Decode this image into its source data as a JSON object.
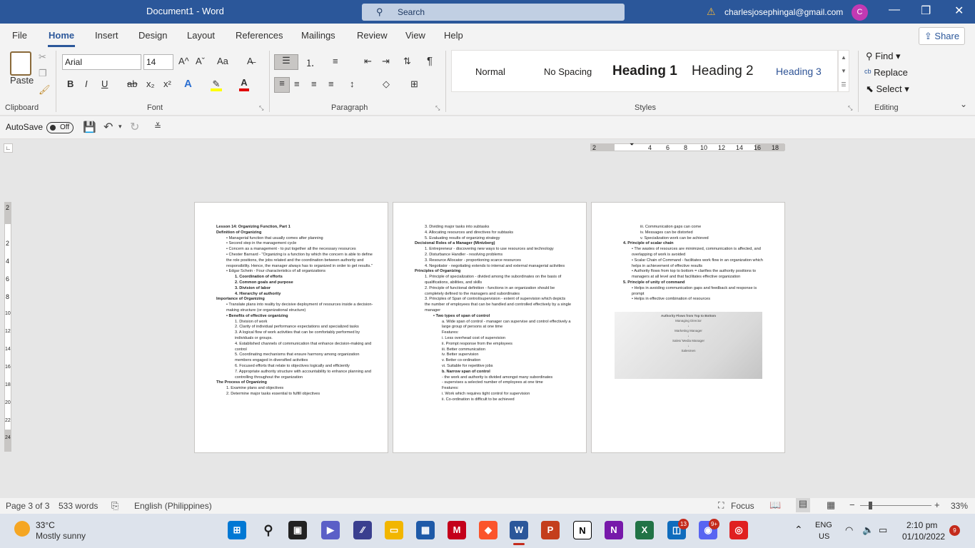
{
  "window": {
    "title": "Document1  -  Word",
    "search_placeholder": "Search",
    "account": "charlesjosephingal@gmail.com",
    "avatar": "C",
    "minimize": "—",
    "restore": "❐",
    "close": "✕"
  },
  "menu": {
    "tabs": [
      "File",
      "Home",
      "Insert",
      "Design",
      "Layout",
      "References",
      "Mailings",
      "Review",
      "View",
      "Help"
    ],
    "active": "Home",
    "share": "Share"
  },
  "ribbon": {
    "clipboard": {
      "paste": "Paste",
      "label": "Clipboard"
    },
    "font": {
      "family": "Arial",
      "size": "14",
      "label": "Font",
      "bold": "B",
      "italic": "I",
      "underline": "U",
      "strike": "ab",
      "sub": "x₂",
      "sup": "x²",
      "grow": "A^",
      "shrink": "Aˇ",
      "case": "Aa",
      "effects": "A",
      "color": "A"
    },
    "paragraph": {
      "label": "Paragraph"
    },
    "styles": {
      "items": [
        "Normal",
        "No Spacing",
        "Heading 1",
        "Heading 2",
        "Heading 3"
      ],
      "label": "Styles"
    },
    "editing": {
      "find": "Find",
      "replace": "Replace",
      "select": "Select",
      "label": "Editing"
    }
  },
  "qat": {
    "autosave": "AutoSave",
    "autosave_state": "Off"
  },
  "ruler": {
    "h_ticks": [
      "2",
      "2",
      "4",
      "6",
      "8",
      "10",
      "12",
      "14",
      "16",
      "18"
    ],
    "v_ticks": [
      "2",
      "2",
      "4",
      "6",
      "8",
      "10",
      "12",
      "14",
      "16",
      "18",
      "20",
      "22",
      "24"
    ]
  },
  "pages": {
    "p1": [
      {
        "t": "Lesson 14: Organizing Function, Part 1",
        "c": "h"
      },
      {
        "t": "Definition of Organizing",
        "c": "h"
      },
      {
        "t": "• Managerial function that usually comes after planning",
        "c": "ind"
      },
      {
        "t": "• Second step in the management cycle",
        "c": "ind"
      },
      {
        "t": "• Concern as a management - to put together all the necessary resources",
        "c": "ind"
      },
      {
        "t": "• Chester Barnard - \"Organizing is a function by which the concern is able to define the role positions, the jobs related and the coordination between authority and responsibility. Hence, the manager always has to organized in order to get results.\"",
        "c": "ind"
      },
      {
        "t": "• Edgar Schein - Four characteristics of all organizations",
        "c": "ind"
      },
      {
        "t": "1. Coordination of efforts",
        "c": "ind2 h"
      },
      {
        "t": "2. Common goals and purpose",
        "c": "ind2 h"
      },
      {
        "t": "3. Division of labor",
        "c": "ind2 h"
      },
      {
        "t": "4. Hierarchy of authority",
        "c": "ind2 h"
      },
      {
        "t": "Importance of Organizing",
        "c": "h"
      },
      {
        "t": "• Translate plans into reality by decisive deployment of resources inside a decision-making structure (or organizational structure)",
        "c": "ind"
      },
      {
        "t": "• Benefits of effective organizing",
        "c": "ind h"
      },
      {
        "t": "1. Division of work",
        "c": "ind2"
      },
      {
        "t": "2. Clarity of individual performance expectations and specialized tasks",
        "c": "ind2"
      },
      {
        "t": "3. A logical flow of work activities that can be comfortably performed by individuals or groups.",
        "c": "ind2"
      },
      {
        "t": "4. Established channels of communication that enhance decision-making and control",
        "c": "ind2"
      },
      {
        "t": "5. Coordinating mechanisms that ensure harmony among organization members engaged in diversified activities",
        "c": "ind2"
      },
      {
        "t": "6. Focused efforts that relate to objectives logically and efficiently",
        "c": "ind2"
      },
      {
        "t": "7. Appropriate authority structure with accountability to enhance planning and controlling throughout the organization",
        "c": "ind2"
      },
      {
        "t": "The Process of Organizing",
        "c": "h"
      },
      {
        "t": "1. Examine plans and objectives",
        "c": "ind"
      },
      {
        "t": "2. Determine major tasks essential to fulfill objectives",
        "c": "ind"
      }
    ],
    "p2": [
      {
        "t": "3. Dividing major tasks into subtasks",
        "c": "ind"
      },
      {
        "t": "4. Allocating resources and directives for subtasks",
        "c": "ind"
      },
      {
        "t": "5. Evaluating results of organizing strategy",
        "c": "ind"
      },
      {
        "t": "Decisional Roles of a Manager (Mintzberg)",
        "c": "h"
      },
      {
        "t": "1. Entrepreneur - discovering new ways to use resources and technology",
        "c": "ind"
      },
      {
        "t": "2. Disturbance Handler - resolving problems",
        "c": "ind"
      },
      {
        "t": "3. Resource Allocator - proportioning scarce resources",
        "c": "ind"
      },
      {
        "t": "4. Negotiator - negotiating extends to internal and external managerial activities",
        "c": "ind"
      },
      {
        "t": "Principles of Organizing",
        "c": "h"
      },
      {
        "t": "1. Principle of specialization - divided among the subordinates on the basis of qualifications, abilities, and skills",
        "c": "ind"
      },
      {
        "t": "2. Principle of functional definition - functions in an organization should be completely defined to the managers and subordinates",
        "c": "ind"
      },
      {
        "t": "3. Principles of Span of control/supervision - extent of supervision which depicts the number of employees that can be handled and controlled effectively by a single manager",
        "c": "ind"
      },
      {
        "t": "• Two types of span of control",
        "c": "ind2 h"
      },
      {
        "t": "a. Wide span of control - manager can supervise and control effectively a large group of persons at one time",
        "c": "ind3"
      },
      {
        "t": "Features:",
        "c": "ind3"
      },
      {
        "t": "i. Less overhead cost of supervision",
        "c": "ind3"
      },
      {
        "t": "ii. Prompt response from the employees",
        "c": "ind3"
      },
      {
        "t": "iii. Better communication",
        "c": "ind3"
      },
      {
        "t": "iv. Better supervision",
        "c": "ind3"
      },
      {
        "t": "v. Better co-ordination",
        "c": "ind3"
      },
      {
        "t": "vi. Suitable for repetitive jobs",
        "c": "ind3"
      },
      {
        "t": "b. Narrow span of control",
        "c": "ind3 h"
      },
      {
        "t": "- the work and authority is divided amongst many subordinates",
        "c": "ind3"
      },
      {
        "t": "- supervises a selected number of employees at one time",
        "c": "ind3"
      },
      {
        "t": "Features:",
        "c": "ind3"
      },
      {
        "t": "i. Work which requires tight control for supervision",
        "c": "ind3"
      },
      {
        "t": "ii. Co-ordination is difficult to be achieved",
        "c": "ind3"
      }
    ],
    "p3": [
      {
        "t": "iii. Communication gaps can come",
        "c": "ind3"
      },
      {
        "t": "iv. Messages can be distorted",
        "c": "ind3"
      },
      {
        "t": "v. Specialization work can be achieved",
        "c": "ind3"
      },
      {
        "t": "4. Principle of scalar chain",
        "c": "ind h"
      },
      {
        "t": "• The wastes of resources are minimized, communication is affected, and overlapping of work is avoided",
        "c": "ind2"
      },
      {
        "t": "• Scalar Chain of Command - facilitates work flow in an organization which helps in achievement of effective results",
        "c": "ind2"
      },
      {
        "t": "• Authority flows from top to bottom = clarifies the authority positions to managers at all level and that facilitates effective organization",
        "c": "ind2"
      },
      {
        "t": "5. Principle of unity of command",
        "c": "ind h"
      },
      {
        "t": "• Helps in avoiding communication gaps and feedback and response is prompt",
        "c": "ind2"
      },
      {
        "t": "• Helps in effective combination of resources",
        "c": "ind2"
      }
    ],
    "diagram": [
      "Authority Flows from Top to Bottom",
      "Managing Director",
      "↓",
      "Marketing Manager",
      "↓",
      "Sales/ Media Manager",
      "↓",
      "Salesmen"
    ]
  },
  "status": {
    "page": "Page 3 of 3",
    "words": "533 words",
    "language": "English (Philippines)",
    "focus": "Focus",
    "zoom": "33%"
  },
  "taskbar": {
    "weather_temp": "33°C",
    "weather_desc": "Mostly sunny",
    "lang": "ENG",
    "region": "US",
    "time": "2:10 pm",
    "date": "01/10/2022",
    "badge_outlook": "13",
    "badge_discord": "9+",
    "badge_notif": "9"
  }
}
